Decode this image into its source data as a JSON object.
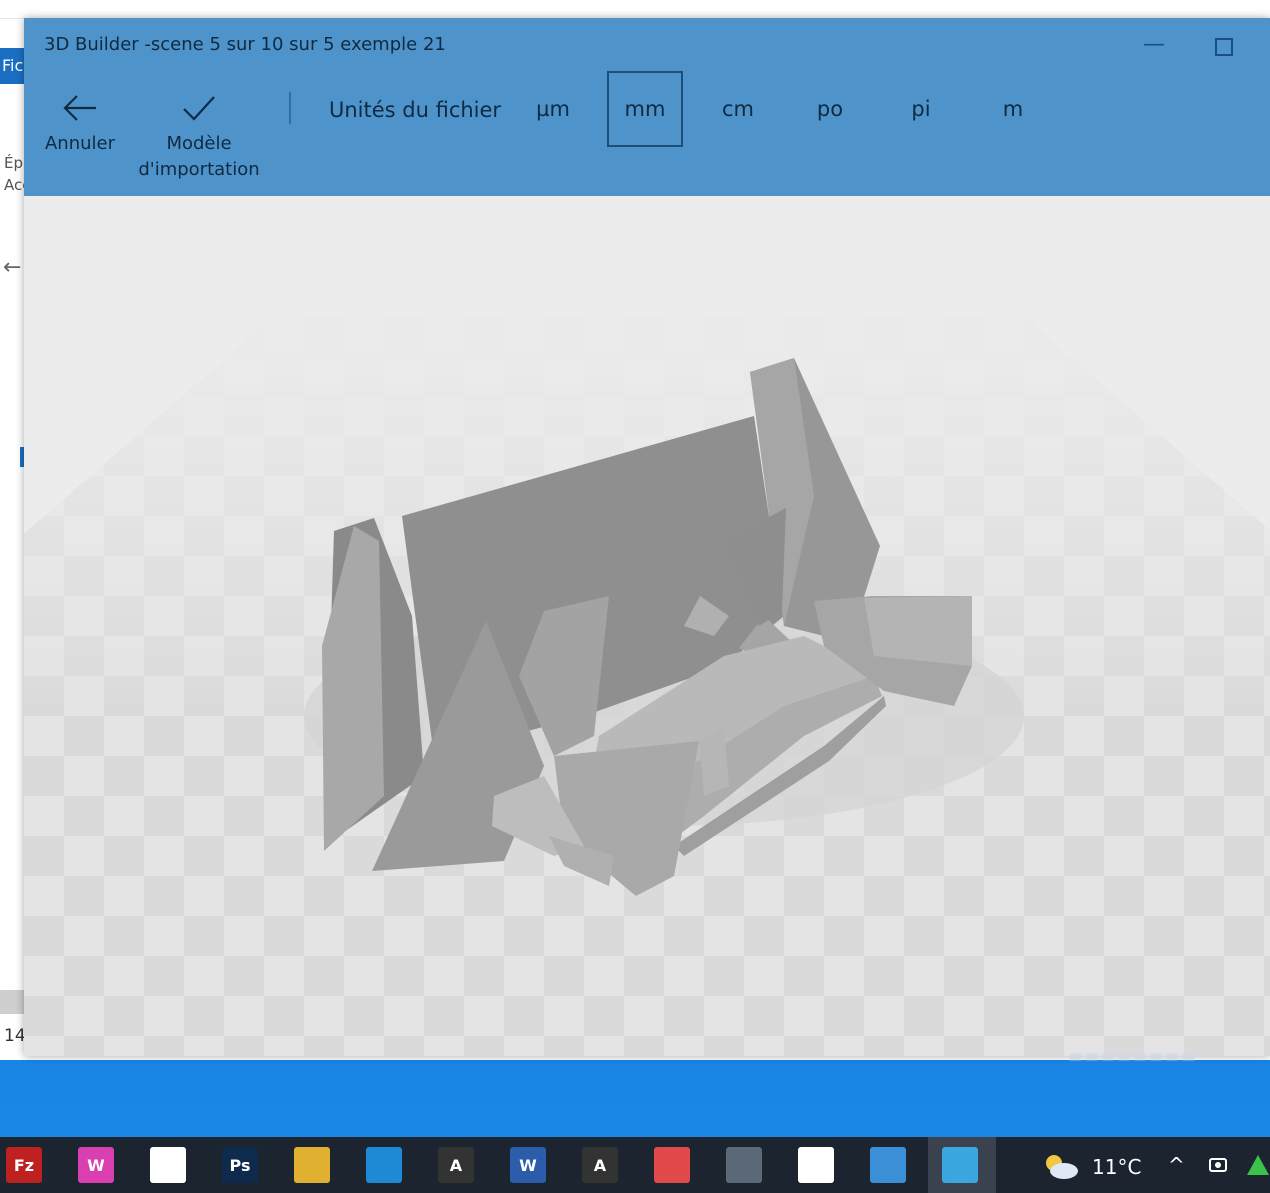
{
  "app": {
    "title": "3D Builder -scene 5 sur 10 sur 5 exemple 21",
    "toolbar": {
      "cancel_label": "Annuler",
      "import_label_line1": "Modèle",
      "import_label_line2": "d'importation",
      "units_label": "Unités du fichier",
      "units": [
        "µm",
        "mm",
        "cm",
        "po",
        "pi",
        "m"
      ],
      "selected_unit": "mm"
    }
  },
  "background_window": {
    "ribbon_tab": "Fic",
    "side_label_1": "Ép",
    "side_label_2": "Acc",
    "status_text": "14"
  },
  "taskbar": {
    "apps": [
      {
        "name": "filezilla",
        "glyph": "Fz",
        "color": "#bf2020"
      },
      {
        "name": "app-pink",
        "glyph": "W",
        "color": "#d93fb0"
      },
      {
        "name": "file",
        "glyph": "",
        "color": "#ffffff"
      },
      {
        "name": "photoshop",
        "glyph": "Ps",
        "color": "#0e2a4c"
      },
      {
        "name": "color-app",
        "glyph": "",
        "color": "#e0b030"
      },
      {
        "name": "vscode",
        "glyph": "",
        "color": "#1e8ad6"
      },
      {
        "name": "autocad-1",
        "glyph": "A",
        "color": "#333333"
      },
      {
        "name": "word",
        "glyph": "W",
        "color": "#2b5dab"
      },
      {
        "name": "autocad-2",
        "glyph": "A",
        "color": "#333333"
      },
      {
        "name": "paint-tool",
        "glyph": "",
        "color": "#e04a4a"
      },
      {
        "name": "calculator",
        "glyph": "",
        "color": "#5b6878"
      },
      {
        "name": "circle-app",
        "glyph": "",
        "color": "#ffffff"
      },
      {
        "name": "photos",
        "glyph": "",
        "color": "#3a8fd6"
      },
      {
        "name": "3d-builder",
        "glyph": "",
        "color": "#3aa7e0"
      }
    ],
    "temperature": "11°C",
    "weather_icon": "partly-cloudy-icon"
  }
}
